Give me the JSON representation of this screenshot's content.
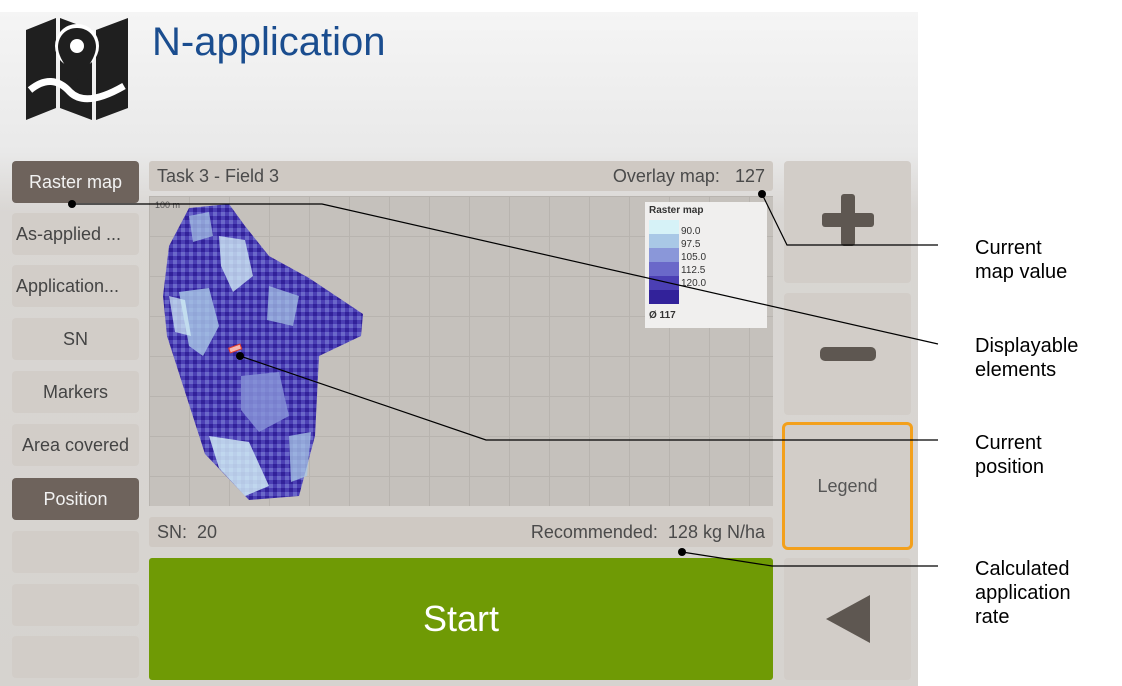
{
  "app": {
    "title": "N-application",
    "icon": "map-pin-icon"
  },
  "sidebar": {
    "items": [
      {
        "label": "Raster map",
        "active": true
      },
      {
        "label": "As-applied ...",
        "active": false
      },
      {
        "label": "Application...",
        "active": false
      },
      {
        "label": "SN",
        "active": false
      },
      {
        "label": "Markers",
        "active": false
      },
      {
        "label": "Area covered",
        "active": false
      },
      {
        "label": "Position",
        "active": true
      },
      {
        "label": "",
        "active": false
      },
      {
        "label": "",
        "active": false
      },
      {
        "label": "",
        "active": false
      }
    ]
  },
  "header_bar": {
    "task": "Task 3 - Field 3",
    "overlay_label": "Overlay map:",
    "overlay_value": "127"
  },
  "map": {
    "scale": "100 m",
    "legend": {
      "title": "Raster map",
      "entries": [
        {
          "value": "90.0",
          "color": "#d6f2f7"
        },
        {
          "value": "97.5",
          "color": "#a9c8e6"
        },
        {
          "value": "105.0",
          "color": "#8a97d9"
        },
        {
          "value": "112.5",
          "color": "#6a68c9"
        },
        {
          "value": "120.0",
          "color": "#4b3fb4"
        },
        {
          "value": "",
          "color": "#32229a"
        }
      ],
      "average": "Ø 117"
    }
  },
  "footer_bar": {
    "sn_label": "SN:",
    "sn_value": "20",
    "recommended_label": "Recommended:",
    "recommended_value": "128 kg N/ha"
  },
  "start_label": "Start",
  "right_panel": {
    "zoom_in": "plus-icon",
    "zoom_out": "minus-icon",
    "legend_label": "Legend",
    "back": "back-arrow-icon"
  },
  "callouts": {
    "current_map_value": "Current\nmap value",
    "displayable_elements": "Displayable\nelements",
    "current_position": "Current\nposition",
    "calculated_rate": "Calculated\napplication\nrate"
  },
  "colors": {
    "accent_green": "#6f9a05",
    "legend_highlight": "#f3a01c",
    "title_blue": "#1a4d8f"
  }
}
